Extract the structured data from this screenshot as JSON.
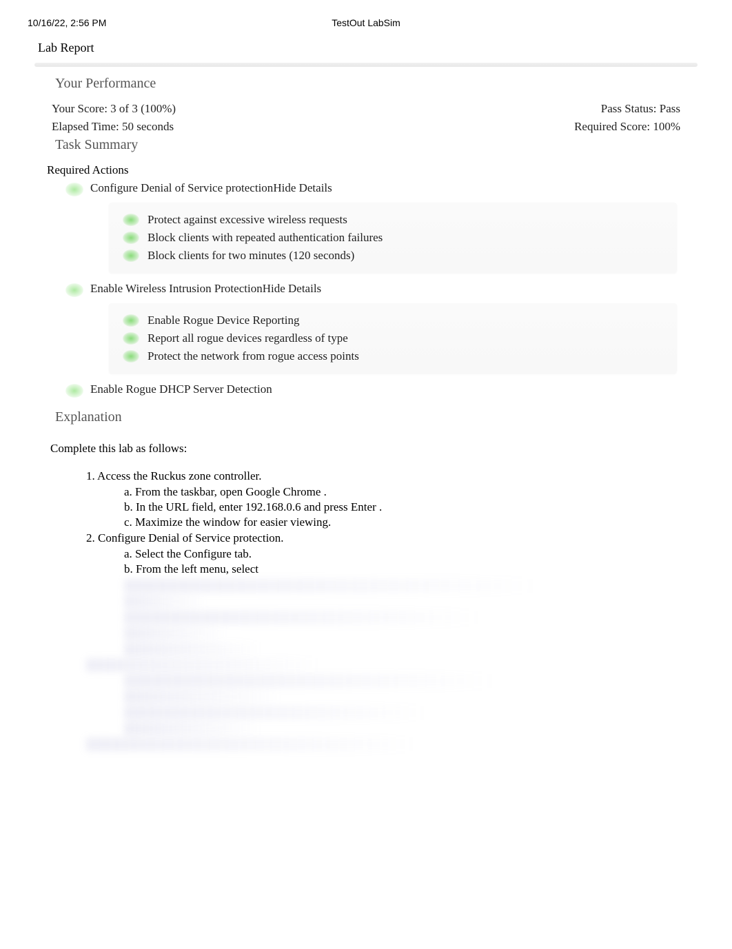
{
  "header": {
    "timestamp": "10/16/22, 2:56 PM",
    "title": "TestOut LabSim"
  },
  "report_title": "Lab Report",
  "performance": {
    "heading": "Your Performance",
    "score_label": "Your Score: 3 of 3 (100%)",
    "pass_status": "Pass Status: Pass",
    "elapsed_time": "Elapsed Time: 50 seconds",
    "required_score": "Required Score: 100%"
  },
  "task_summary": {
    "heading": "Task Summary",
    "required_actions_label": "Required Actions",
    "actions": [
      {
        "label": "Configure Denial of Service protection",
        "hide_details": "Hide Details",
        "details": [
          "Protect against excessive wireless requests",
          "Block clients with repeated authentication failures",
          "Block clients for two minutes (120 seconds)"
        ]
      },
      {
        "label": "Enable Wireless Intrusion Protection",
        "hide_details": "Hide Details",
        "details": [
          "Enable Rogue Device Reporting",
          "Report all rogue devices regardless of type",
          "Protect the network from rogue access points"
        ]
      },
      {
        "label": "Enable Rogue DHCP Server Detection",
        "hide_details": "",
        "details": []
      }
    ]
  },
  "explanation": {
    "heading": "Explanation",
    "intro": "Complete this lab as follows:",
    "steps": [
      {
        "num": "1. Access the Ruckus zone controller.",
        "subs": [
          "a. From the taskbar, open Google Chrome .",
          "b. In the URL field, enter 192.168.0.6 and press Enter .",
          "c. Maximize the window for easier viewing."
        ]
      },
      {
        "num": "2. Configure Denial of Service protection.",
        "subs": [
          "a. Select the Configure  tab.",
          "b. From the left menu, select"
        ]
      }
    ]
  }
}
